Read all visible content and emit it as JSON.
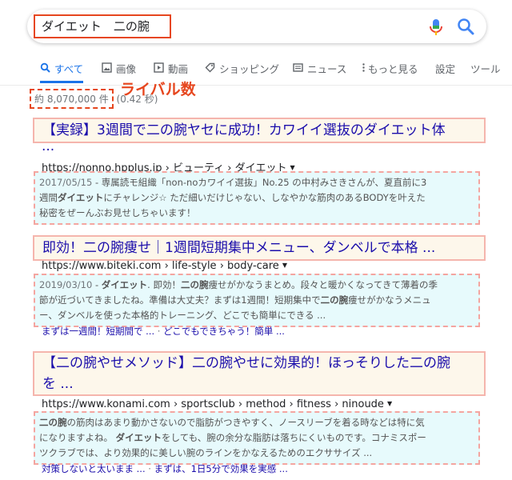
{
  "search": {
    "query": "ダイエット　二の腕"
  },
  "tabs": [
    {
      "label": "すべて",
      "icon": "search-icon"
    },
    {
      "label": "画像",
      "icon": "image-icon"
    },
    {
      "label": "動画",
      "icon": "play-icon"
    },
    {
      "label": "ショッピング",
      "icon": "tag-icon"
    },
    {
      "label": "ニュース",
      "icon": "news-icon"
    },
    {
      "label": "もっと見る",
      "icon": "more-vert-icon"
    },
    {
      "label": "設定"
    },
    {
      "label": "ツール"
    }
  ],
  "stats": {
    "count": "約 8,070,000 件",
    "time": "(0.42 秒)",
    "annotation": "ライバル数"
  },
  "results": [
    {
      "title": "【実録】3週間で二の腕ヤセに成功！カワイイ選抜のダイエット体",
      "title_cont": "...",
      "url": "https://nonno.hpplus.jp › ビューティ › ダイエット",
      "snippet": {
        "date": "2017/05/15",
        "dash": " - ",
        "line1": "専属読モ組織「non-noカワイイ選抜」No.25 の中村みさきさんが、夏直前に3",
        "line2a": "週間",
        "line2b": "ダイエット",
        "line2c": "にチャレンジ☆ ただ細いだけじゃない、しなやかな筋肉のあるBODYを叶えた",
        "line3": "秘密をぜーんぶお見せしちゃいます！"
      }
    },
    {
      "title": "即効！二の腕痩せ｜1週間短期集中メニュー、ダンベルで本格 ...",
      "url": "https://www.biteki.com › life-style › body-care",
      "snippet": {
        "date": "2019/03/10",
        "dash": " - ",
        "line1a": "ダイエット",
        "line1b": ". 即効！",
        "line1c": "二の腕",
        "line1d": "痩せがかなうまとめ。段々と暖かくなってきて薄着の季",
        "line2a": "節が近づいてきましたね。準備は大丈夫？まずは1週間！短期集中で",
        "line2b": "二の腕",
        "line2c": "痩せがかなうメニュ",
        "line3": "ー、ダンベルを使った本格的トレーニング、どこでも簡単にできる ..."
      },
      "sitelinks": [
        "まずは一週間！短期間で ...",
        "どこでもできちゃう！簡単 ..."
      ]
    },
    {
      "title": "【二の腕やせメソッド】二の腕やせに効果的！ほっそりした二の腕",
      "title_line2": "を ...",
      "url": "https://www.konami.com › sportsclub › method › fitness › ninoude",
      "snippet": {
        "line1a": "二の腕",
        "line1b": "の筋肉はあまり動かさないので脂肪がつきやすく、ノースリーブを着る時などは特に気",
        "line2a": "になりますよね。 ",
        "line2b": "ダイエット",
        "line2c": "をしても、腕の余分な脂肪は落ちにくいものです。コナミスポー",
        "line3": "ツクラブでは、より効果的に美しい腕のラインをかなえるためのエクササイズ ..."
      },
      "sitelinks": [
        "対策しないと太いまま ...",
        "まずは、1日5分で効果を実感 ..."
      ]
    }
  ],
  "colors": {
    "annotation_red": "#e6461e",
    "link_blue": "#1a0dab",
    "tab_active": "#1a73e8",
    "title_box_bg": "#fdf7eb",
    "snippet_box_bg": "#e7fafc"
  }
}
